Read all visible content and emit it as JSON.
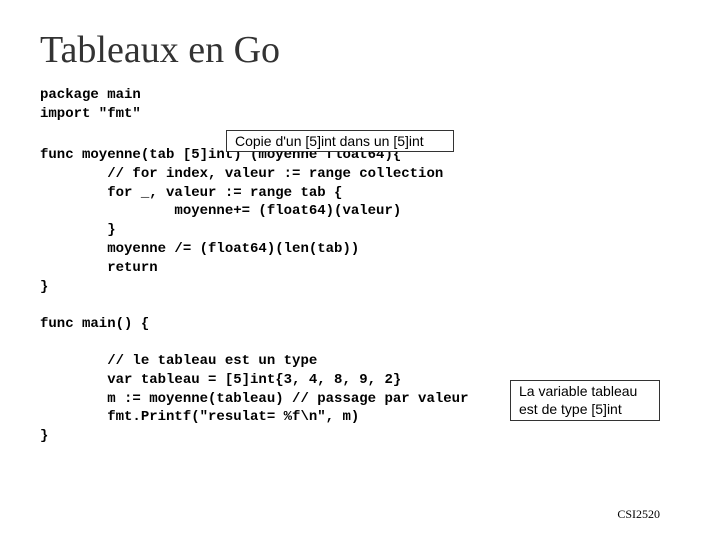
{
  "title": "Tableaux en Go",
  "callout_top": "Copie d'un [5]int dans un [5]int",
  "callout_right": "La variable tableau est de type [5]int",
  "code_block1": "package main\nimport \"fmt\"",
  "code_block2": "func moyenne(tab [5]int) (moyenne float64){\n        // for index, valeur := range collection\n        for _, valeur := range tab {\n                moyenne+= (float64)(valeur)\n        }\n        moyenne /= (float64)(len(tab))\n        return\n}",
  "code_block3": "func main() {",
  "code_block4": "        // le tableau est un type\n        var tableau = [5]int{3, 4, 8, 9, 2}\n        m := moyenne(tableau) // passage par valeur\n        fmt.Printf(\"resulat= %f\\n\", m)\n}",
  "footer": "CSI2520"
}
